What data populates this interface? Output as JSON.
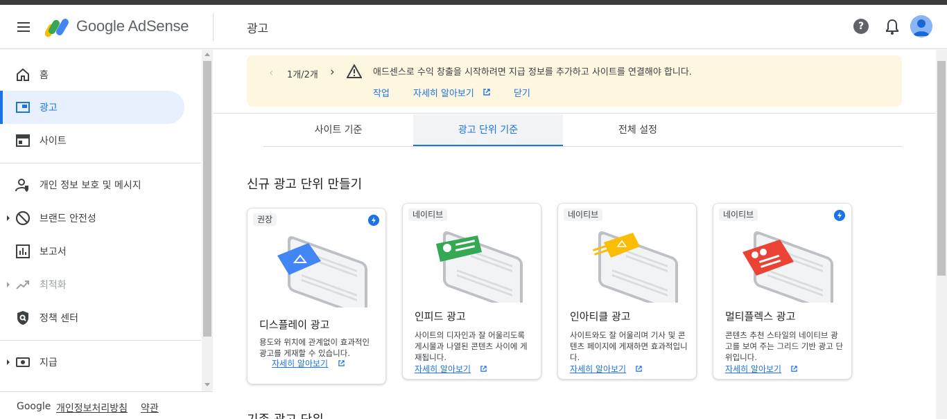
{
  "header": {
    "brand": "Google AdSense",
    "page_title": "광고",
    "help_glyph": "?"
  },
  "sidebar": {
    "items": [
      {
        "label": "홈",
        "icon": "home-icon"
      },
      {
        "label": "광고",
        "icon": "ads-icon",
        "active": true
      },
      {
        "label": "사이트",
        "icon": "sites-icon"
      },
      {
        "label": "개인 정보 보호 및 메시지",
        "icon": "privacy-icon"
      },
      {
        "label": "브랜드 안전성",
        "icon": "block-icon"
      },
      {
        "label": "보고서",
        "icon": "reports-icon"
      },
      {
        "label": "최적화",
        "icon": "trending-icon",
        "disabled": true
      },
      {
        "label": "정책 센터",
        "icon": "policy-shield-icon"
      },
      {
        "label": "지급",
        "icon": "payments-icon"
      }
    ],
    "footer": {
      "google": "Google",
      "privacy": "개인정보처리방침",
      "terms": "약관"
    }
  },
  "banner": {
    "pager": "1개/2개",
    "message": "애드센스로 수익 창출을 시작하려면 지급 정보를 추가하고 사이트를 연결해야 합니다.",
    "action_work": "작업",
    "action_learn": "자세히 알아보기",
    "action_close": "닫기"
  },
  "tabs": [
    "사이트 기준",
    "광고 단위 기준",
    "전체 설정"
  ],
  "section_title": "신규 광고 단위 만들기",
  "cards": [
    {
      "tag": "권장",
      "title": "디스플레이 광고",
      "desc": "용도와 위치에 관계없이 효과적인 광고를 게재할 수 있습니다.",
      "more": "자세히 알아보기",
      "accent": "#4285f4"
    },
    {
      "tag": "네이티브",
      "title": "인피드 광고",
      "desc": "사이트의 디자인과 잘 어울리도록 게시물과 나열된 콘텐츠 사이에 게재됩니다.",
      "more": "자세히 알아보기",
      "accent": "#34a853"
    },
    {
      "tag": "네이티브",
      "title": "인아티클 광고",
      "desc": "사이트와도 잘 어울리며 기사 및 콘텐츠 페이지에 게재하면 효과적입니다.",
      "more": "자세히 알아보기",
      "accent": "#fbbc04"
    },
    {
      "tag": "네이티브",
      "title": "멀티플렉스 광고",
      "desc": "콘텐츠 추천 스타일의 네이티브 광고를 보여 주는 그리드 기반 광고 단위입니다.",
      "more": "자세히 알아보기",
      "accent": "#ea4335"
    }
  ],
  "subsection_title": "기존 광고 단위",
  "colors": {
    "accent": "#1a73e8",
    "banner_bg": "#fef7e0"
  }
}
